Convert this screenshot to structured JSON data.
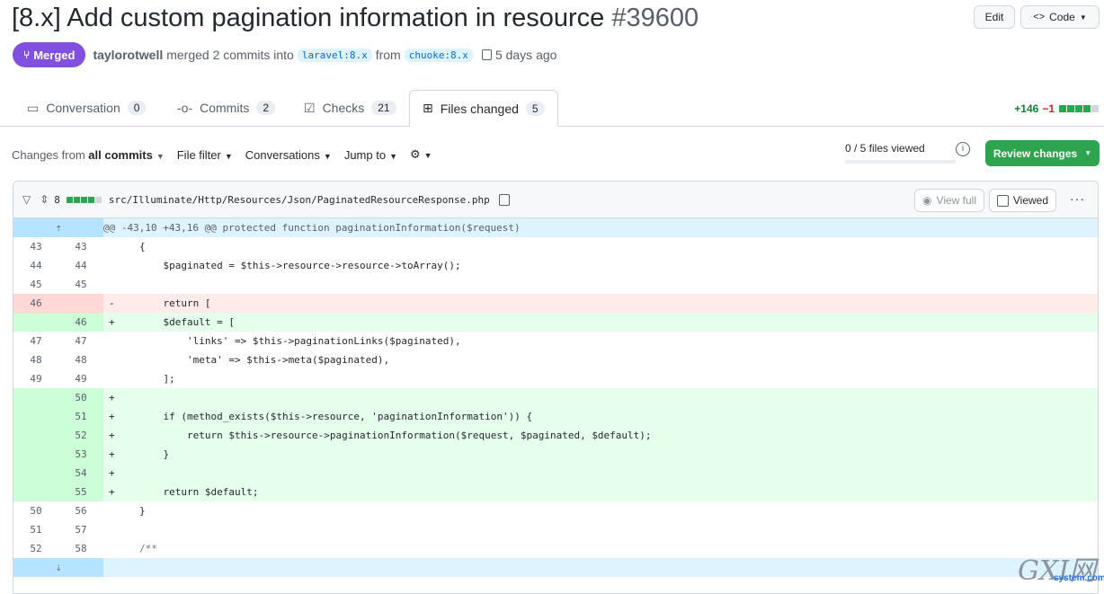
{
  "header": {
    "title": "[8.x] Add custom pagination information in resource",
    "number": "#39600",
    "edit_label": "Edit",
    "code_label": "Code",
    "code_icon": "<>"
  },
  "meta": {
    "status": "Merged",
    "author": "taylorotwell",
    "merged_text": "merged 2 commits into",
    "base_branch": "laravel:8.x",
    "from_text": "from",
    "head_branch": "chuoke:8.x",
    "time_ago": "5 days ago"
  },
  "tabs": [
    {
      "label": "Conversation",
      "count": "0",
      "icon": "comment-icon"
    },
    {
      "label": "Commits",
      "count": "2",
      "icon": "commit-icon"
    },
    {
      "label": "Checks",
      "count": "21",
      "icon": "checklist-icon"
    },
    {
      "label": "Files changed",
      "count": "5",
      "icon": "file-diff-icon",
      "active": true
    }
  ],
  "diffstat": {
    "additions": "+146",
    "deletions": "−1"
  },
  "toolbar": {
    "changes_prefix": "Changes from",
    "changes_value": "all commits",
    "file_filter": "File filter",
    "conversations": "Conversations",
    "jump_to": "Jump to",
    "files_viewed": "0 / 5 files viewed",
    "review_label": "Review changes"
  },
  "file": {
    "changes": "8",
    "path": "src/Illuminate/Http/Resources/Json/PaginatedResourceResponse.php",
    "view_full": "View full",
    "viewed": "Viewed"
  },
  "diff": {
    "hunk": "@@ -43,10 +43,16 @@ protected function paginationInformation($request)",
    "lines": [
      {
        "old": "43",
        "new": "43",
        "type": "ctx",
        "code": "{"
      },
      {
        "old": "44",
        "new": "44",
        "type": "ctx",
        "code": "    $paginated = $this->resource->resource->toArray();"
      },
      {
        "old": "45",
        "new": "45",
        "type": "ctx",
        "code": ""
      },
      {
        "old": "46",
        "new": "",
        "type": "del",
        "code": "    return ["
      },
      {
        "old": "",
        "new": "46",
        "type": "add",
        "code": "    $default = ["
      },
      {
        "old": "47",
        "new": "47",
        "type": "ctx",
        "code": "        'links' => $this->paginationLinks($paginated),"
      },
      {
        "old": "48",
        "new": "48",
        "type": "ctx",
        "code": "        'meta' => $this->meta($paginated),"
      },
      {
        "old": "49",
        "new": "49",
        "type": "ctx",
        "code": "    ];"
      },
      {
        "old": "",
        "new": "50",
        "type": "add",
        "code": ""
      },
      {
        "old": "",
        "new": "51",
        "type": "add",
        "code": "    if (method_exists($this->resource, 'paginationInformation')) {"
      },
      {
        "old": "",
        "new": "52",
        "type": "add",
        "code": "        return $this->resource->paginationInformation($request, $paginated, $default);"
      },
      {
        "old": "",
        "new": "53",
        "type": "add",
        "code": "    }"
      },
      {
        "old": "",
        "new": "54",
        "type": "add",
        "code": ""
      },
      {
        "old": "",
        "new": "55",
        "type": "add",
        "code": "    return $default;"
      },
      {
        "old": "50",
        "new": "56",
        "type": "ctx",
        "code": "}"
      },
      {
        "old": "51",
        "new": "57",
        "type": "ctx",
        "code": ""
      },
      {
        "old": "52",
        "new": "58",
        "type": "ctx",
        "code": "/**"
      }
    ]
  },
  "watermark": {
    "text": "GXI网",
    "sub": "system.com"
  },
  "colors": {
    "merged": "#8250df",
    "review": "#2da44e",
    "add": "#e6ffec",
    "del": "#ffebe9",
    "hunk": "#ddf4ff"
  }
}
